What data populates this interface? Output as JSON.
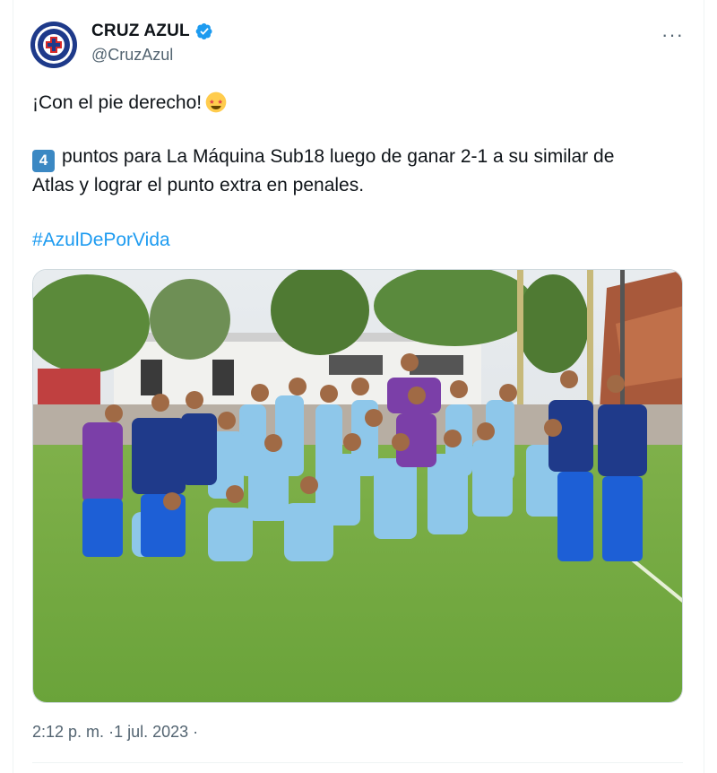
{
  "author": {
    "name": "CRUZ AZUL",
    "handle": "@CruzAzul",
    "verified": true,
    "avatar_icon": "cruz-azul-crest",
    "brand_color": "#1e3a8a"
  },
  "more_label": "···",
  "tweet": {
    "line1": "¡Con el pie derecho!",
    "line1_emoji": "star-struck-emoji",
    "keycap": "4",
    "para2": "puntos para La Máquina Sub18 luego de ganar 2-1 a su similar de Atlas y lograr el punto extra en penales.",
    "hashtag": "#AzulDePorVida",
    "hashtag_color": "#1d9bf0"
  },
  "photo": {
    "icon": "team-photo"
  },
  "meta": {
    "time": "2:12 p. m.",
    "separator": "·",
    "date": "1 jul. 2023",
    "trailing": "·"
  }
}
